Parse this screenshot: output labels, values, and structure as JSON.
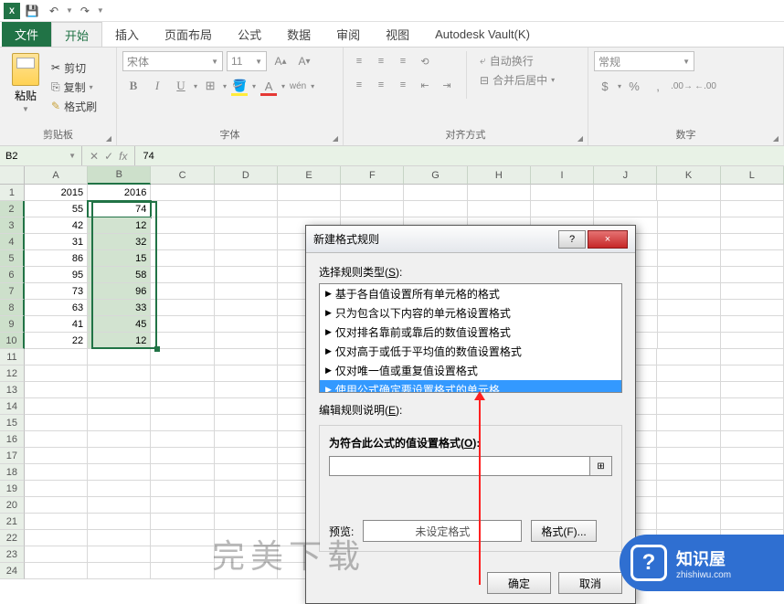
{
  "qat": {
    "save": "💾",
    "undo": "↶",
    "redo": "↷"
  },
  "tabs": {
    "file": "文件",
    "home": "开始",
    "insert": "插入",
    "layout": "页面布局",
    "formula": "公式",
    "data": "数据",
    "review": "审阅",
    "view": "视图",
    "vault": "Autodesk Vault(K)"
  },
  "ribbon": {
    "clipboard": {
      "paste": "粘贴",
      "cut": "剪切",
      "copy": "复制",
      "brush": "格式刷",
      "label": "剪贴板"
    },
    "font": {
      "name": "宋体",
      "size": "11",
      "label": "字体",
      "b": "B",
      "i": "I",
      "u": "U",
      "wen": "wén"
    },
    "align": {
      "label": "对齐方式",
      "wrap": "自动换行",
      "merge": "合并后居中"
    },
    "number": {
      "label": "数字",
      "general": "常规"
    }
  },
  "namebox": "B2",
  "formula_value": "74",
  "columns": [
    "A",
    "B",
    "C",
    "D",
    "E",
    "F",
    "G",
    "H",
    "I",
    "J",
    "K",
    "L"
  ],
  "data_rows": [
    [
      "2015",
      "2016"
    ],
    [
      "55",
      "74"
    ],
    [
      "42",
      "12"
    ],
    [
      "31",
      "32"
    ],
    [
      "86",
      "15"
    ],
    [
      "95",
      "58"
    ],
    [
      "73",
      "96"
    ],
    [
      "63",
      "33"
    ],
    [
      "41",
      "45"
    ],
    [
      "22",
      "12"
    ]
  ],
  "total_rows": 24,
  "dialog": {
    "title": "新建格式规则",
    "rule_type_label": "选择规则类型(",
    "rule_type_key": "S",
    "rule_type_close": "):",
    "rules": [
      "基于各自值设置所有单元格的格式",
      "只为包含以下内容的单元格设置格式",
      "仅对排名靠前或靠后的数值设置格式",
      "仅对高于或低于平均值的数值设置格式",
      "仅对唯一值或重复值设置格式",
      "使用公式确定要设置格式的单元格"
    ],
    "selected_rule": 5,
    "edit_label": "编辑规则说明(",
    "edit_key": "E",
    "edit_close": "):",
    "formula_label": "为符合此公式的值设置格式(",
    "formula_key": "O",
    "formula_close": "):",
    "preview_label": "预览:",
    "preview_text": "未设定格式",
    "format_btn": "格式(F)...",
    "ok": "确定",
    "cancel": "取消",
    "help": "?",
    "close": "×"
  },
  "watermark": "完美下载",
  "logo": {
    "cn": "知识屋",
    "en": "zhishiwu.com",
    "q": "?"
  }
}
